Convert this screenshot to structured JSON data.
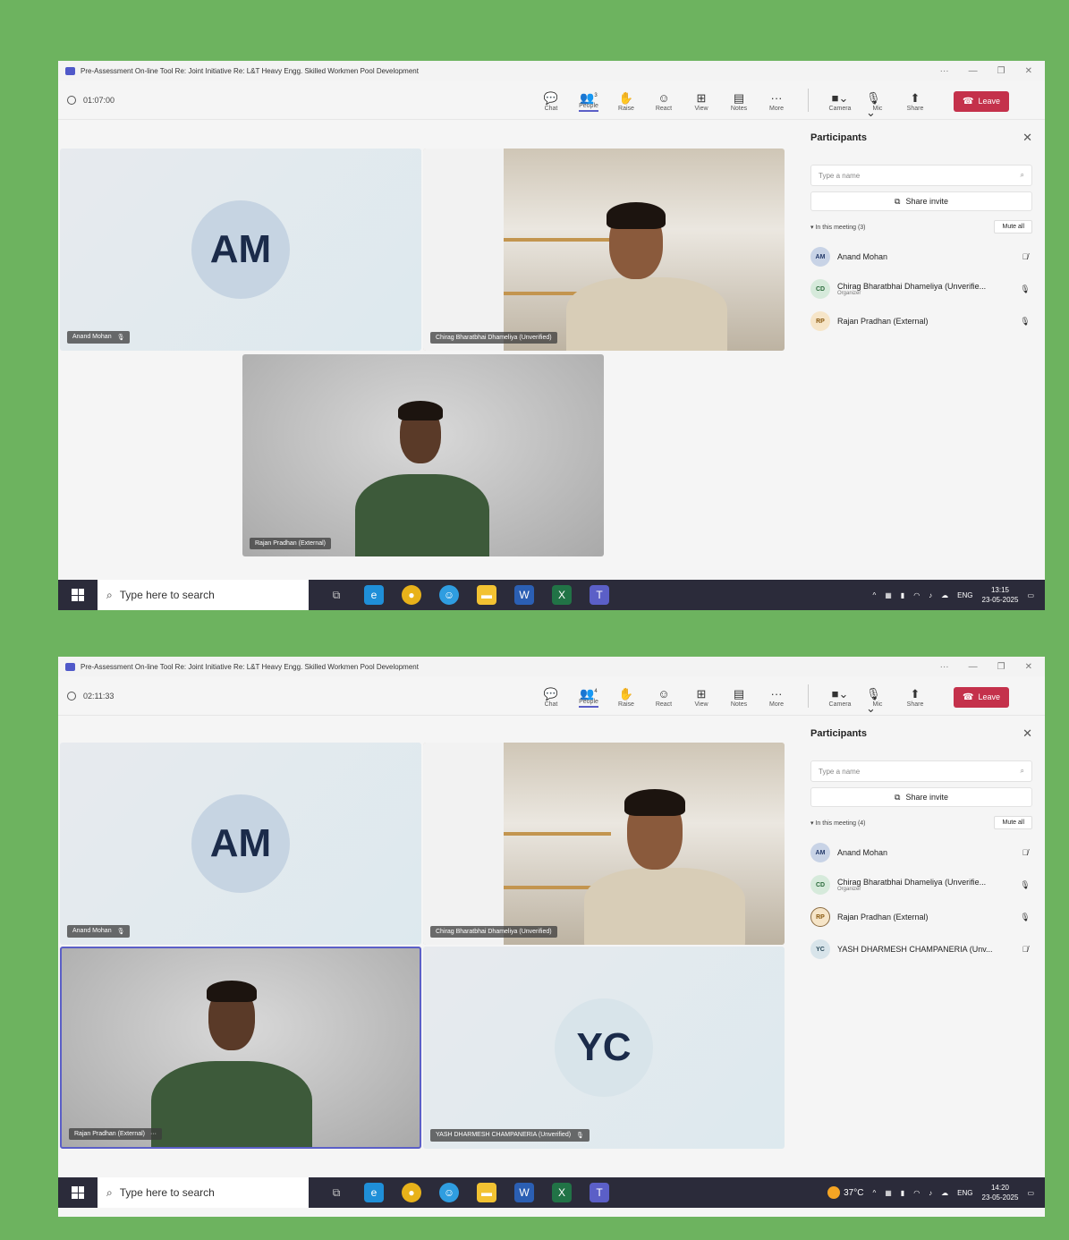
{
  "screens": [
    {
      "title": "Pre-Assessment On-line Tool Re: Joint Initiative Re: L&T Heavy Engg. Skilled Workmen Pool Development",
      "timer": "01:07:00",
      "people_count": "3",
      "participants_header": "Participants",
      "search_placeholder": "Type a name",
      "share_invite": "Share invite",
      "in_meeting": "In this meeting (3)",
      "mute_all": "Mute all",
      "participants": [
        {
          "initials": "AM",
          "name": "Anand Mohan",
          "role": "",
          "mic": "muted"
        },
        {
          "initials": "CD",
          "name": "Chirag Bharatbhai Dhameliya (Unverifie...",
          "role": "Organizer",
          "mic": "on"
        },
        {
          "initials": "RP",
          "name": "Rajan Pradhan (External)",
          "role": "",
          "mic": "on"
        }
      ],
      "tiles": {
        "am_initials": "AM",
        "am_name": "Anand Mohan",
        "chirag_name": "Chirag Bharatbhai Dhameliya (Unverified)",
        "rajan_name": "Rajan Pradhan (External)"
      },
      "taskbar": {
        "search": "Type here to search",
        "lang": "ENG",
        "time": "13:15",
        "date": "23-05-2025"
      }
    },
    {
      "title": "Pre-Assessment On-line Tool Re: Joint Initiative Re: L&T Heavy Engg. Skilled Workmen Pool Development",
      "timer": "02:11:33",
      "people_count": "4",
      "participants_header": "Participants",
      "search_placeholder": "Type a name",
      "share_invite": "Share invite",
      "in_meeting": "In this meeting (4)",
      "mute_all": "Mute all",
      "participants": [
        {
          "initials": "AM",
          "name": "Anand Mohan",
          "role": "",
          "mic": "muted"
        },
        {
          "initials": "CD",
          "name": "Chirag Bharatbhai Dhameliya (Unverifie...",
          "role": "Organizer",
          "mic": "on"
        },
        {
          "initials": "RP",
          "name": "Rajan Pradhan (External)",
          "role": "",
          "mic": "on"
        },
        {
          "initials": "YC",
          "name": "YASH DHARMESH CHAMPANERIA (Unv...",
          "role": "",
          "mic": "muted"
        }
      ],
      "tiles": {
        "am_initials": "AM",
        "am_name": "Anand Mohan",
        "chirag_name": "Chirag Bharatbhai Dhameliya (Unverified)",
        "rajan_name": "Rajan Pradhan (External)",
        "yc_initials": "YC",
        "yc_name": "YASH DHARMESH CHAMPANERIA (Unverified)"
      },
      "taskbar": {
        "search": "Type here to search",
        "weather": "37°C",
        "lang": "ENG",
        "time": "14:20",
        "date": "23-05-2025"
      }
    }
  ],
  "toolbar": {
    "chat": "Chat",
    "people": "People",
    "raise": "Raise",
    "react": "React",
    "view": "View",
    "notes": "Notes",
    "more": "More",
    "camera": "Camera",
    "mic": "Mic",
    "share": "Share",
    "leave": "Leave"
  },
  "colors": {
    "background": "#6db35f",
    "leave": "#c4314b",
    "accent": "#5b5fc7",
    "taskbar": "#2b2b3a"
  }
}
